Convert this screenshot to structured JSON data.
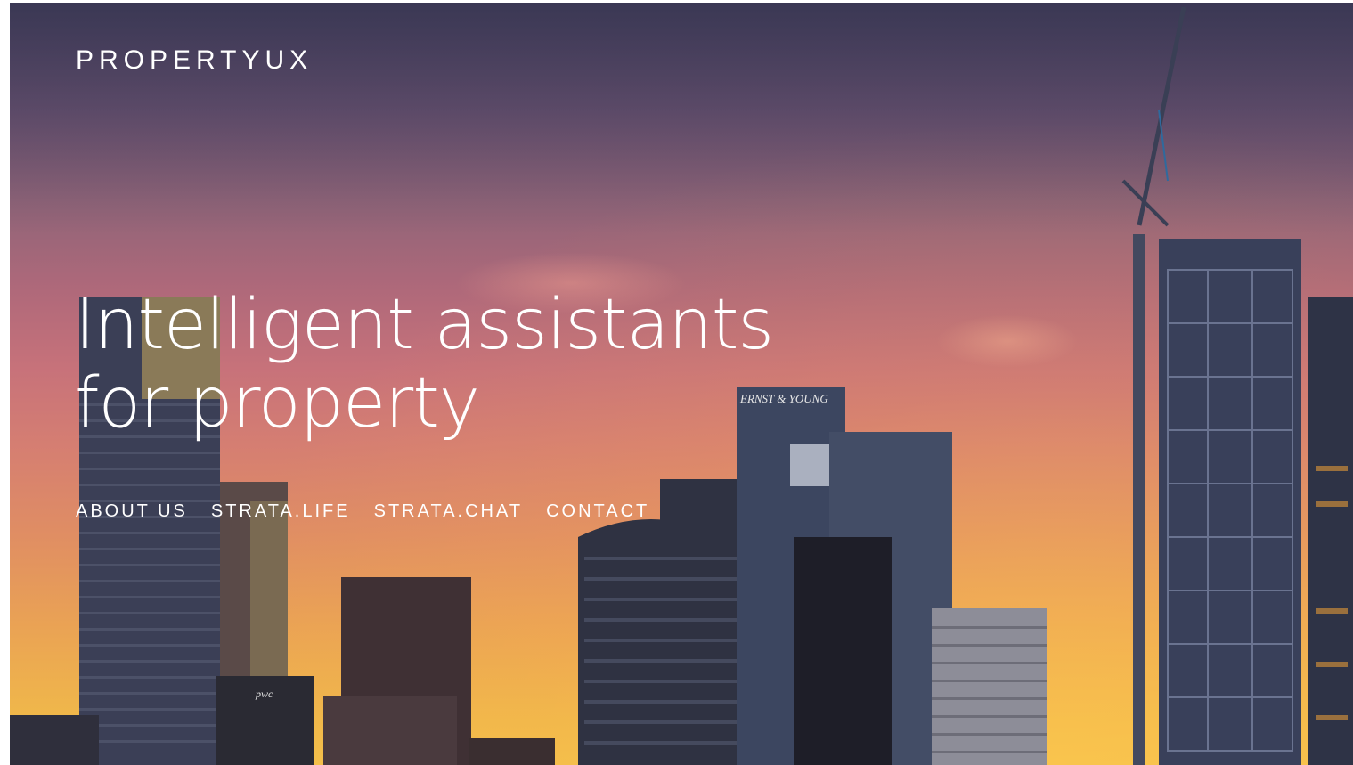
{
  "site": {
    "logo": "PROPERTYUX",
    "headline_line1": "Intelligent assistants",
    "headline_line2": "for property"
  },
  "nav": {
    "items": [
      {
        "label": "ABOUT US"
      },
      {
        "label": "STRATA.LIFE"
      },
      {
        "label": "STRATA.CHAT"
      },
      {
        "label": "CONTACT"
      }
    ]
  },
  "background": {
    "signs": {
      "ey": "ERNST & YOUNG",
      "pwc": "pwc"
    }
  },
  "colors": {
    "text": "#ffffff",
    "sky_top": "#4a4560",
    "sky_mid": "#c7727a",
    "sky_bottom": "#f3c04a"
  }
}
